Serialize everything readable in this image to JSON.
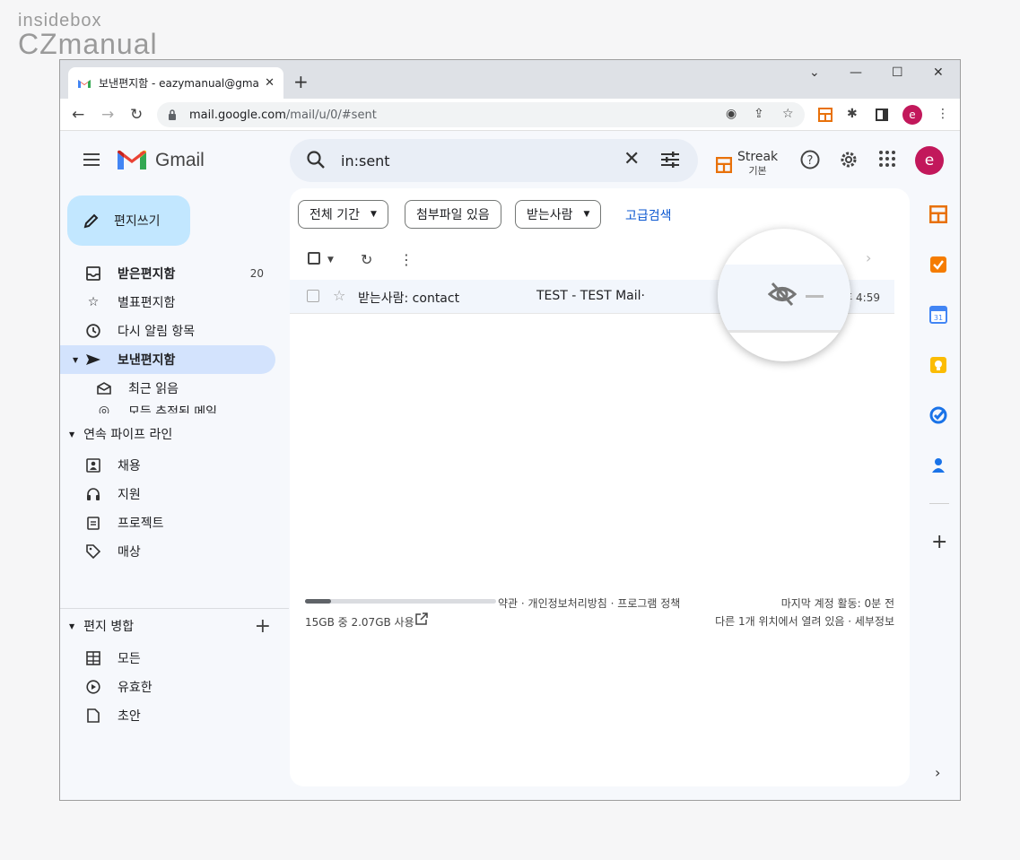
{
  "watermark": {
    "top": "insidebox",
    "bottom": "CZmanual"
  },
  "browser": {
    "tab_title": "보낸편지함 - eazymanual@gma",
    "tab_close": "✕",
    "newtab": "+",
    "url_host": "mail.google.com",
    "url_path": "/mail/u/0/#sent",
    "avatar_letter": "e",
    "win_min": "—",
    "win_max": "☐",
    "win_close": "✕",
    "win_menu": "⌄"
  },
  "header": {
    "app_name": "Gmail",
    "search_query": "in:sent",
    "streak_label": "Streak",
    "streak_sub": "기본",
    "avatar_letter": "e"
  },
  "compose": {
    "label": "편지쓰기"
  },
  "nav": {
    "items": [
      {
        "label": "받은편지함",
        "count": "20"
      },
      {
        "label": "별표편지함"
      },
      {
        "label": "다시 알림 항목"
      },
      {
        "label": "보낸편지함"
      },
      {
        "label": "최근 읽음"
      },
      {
        "label": "모든 추적된 메일"
      }
    ],
    "pipeline_header": "연속 파이프 라인",
    "pipeline_items": [
      {
        "label": "채용"
      },
      {
        "label": "지원"
      },
      {
        "label": "프로젝트"
      },
      {
        "label": "매상"
      }
    ],
    "merge_header": "편지 병합",
    "merge_items": [
      {
        "label": "모든"
      },
      {
        "label": "유효한"
      },
      {
        "label": "초안"
      }
    ]
  },
  "filters": {
    "chips": [
      "전체 기간",
      "첨부파일 있음",
      "받는사람"
    ],
    "advanced": "고급검색"
  },
  "mail": {
    "rows": [
      {
        "from": "받는사람: contact",
        "subject": "TEST - TEST Mail·",
        "time": "오후 4:59"
      }
    ]
  },
  "footer": {
    "storage": "15GB 중 2.07GB 사용",
    "storage_used_fraction": 0.138,
    "links": "약관 · 개인정보처리방침 · 프로그램 정책",
    "last_activity": "마지막 계정 활동: 0분 전",
    "details": "다른 1개 위치에서 열려 있음 · 세부정보"
  },
  "colors": {
    "accent": "#0b57d0",
    "compose_bg": "#c2e7ff",
    "active_nav": "#d3e3fd",
    "avatar": "#c2185b"
  }
}
